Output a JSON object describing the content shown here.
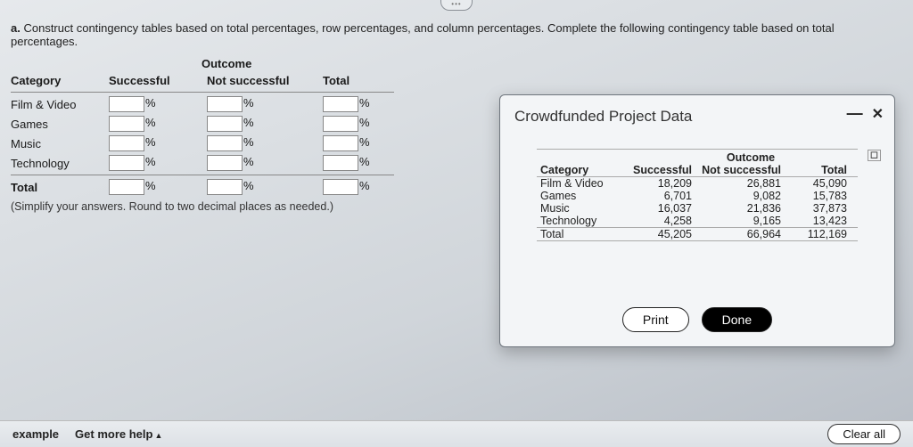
{
  "question": {
    "label": "a.",
    "text": "Construct contingency tables based on total percentages, row percentages, and column percentages. Complete the following contingency table based on total percentages."
  },
  "contingency": {
    "outcome_label": "Outcome",
    "headers": {
      "category": "Category",
      "successful": "Successful",
      "not_successful": "Not successful",
      "total": "Total"
    },
    "rows": [
      "Film & Video",
      "Games",
      "Music",
      "Technology",
      "Total"
    ],
    "pct_symbol": "%",
    "note": "(Simplify your answers. Round to two decimal places as needed.)"
  },
  "dialog": {
    "title": "Crowdfunded Project Data",
    "outcome_label": "Outcome",
    "headers": {
      "category": "Category",
      "successful": "Successful",
      "not_successful": "Not successful",
      "total": "Total"
    },
    "rows": [
      {
        "category": "Film & Video",
        "successful": "18,209",
        "not_successful": "26,881",
        "total": "45,090"
      },
      {
        "category": "Games",
        "successful": "6,701",
        "not_successful": "9,082",
        "total": "15,783"
      },
      {
        "category": "Music",
        "successful": "16,037",
        "not_successful": "21,836",
        "total": "37,873"
      },
      {
        "category": "Technology",
        "successful": "4,258",
        "not_successful": "9,165",
        "total": "13,423"
      },
      {
        "category": "Total",
        "successful": "45,205",
        "not_successful": "66,964",
        "total": "112,169"
      }
    ],
    "buttons": {
      "print": "Print",
      "done": "Done"
    }
  },
  "footer": {
    "example": "example",
    "get_more_help": "Get more help",
    "clear_all": "Clear all"
  }
}
